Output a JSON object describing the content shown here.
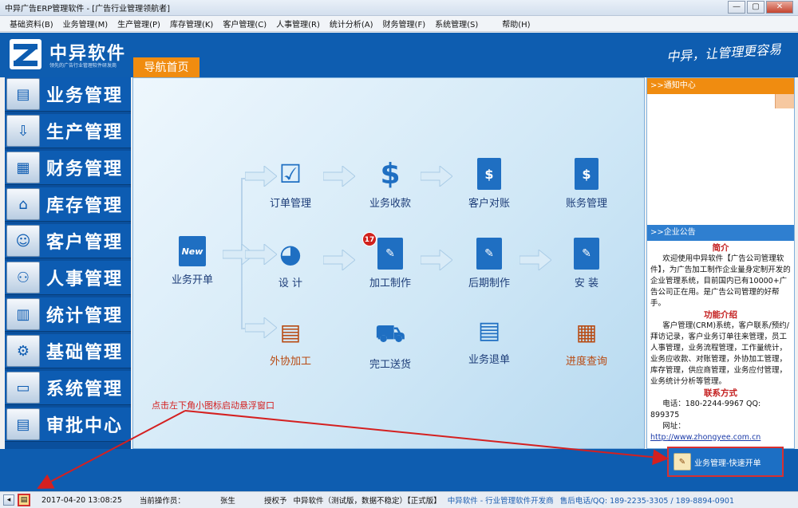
{
  "window": {
    "title": "中异广告ERP管理软件 - [广告行业管理领航者]",
    "minimize": "—",
    "restore": "▢",
    "close": "✕"
  },
  "menu": [
    "基础资料(B)",
    "业务管理(M)",
    "生产管理(P)",
    "库存管理(K)",
    "客户管理(C)",
    "人事管理(R)",
    "统计分析(A)",
    "财务管理(F)",
    "系统管理(S)",
    "帮助(H)"
  ],
  "header": {
    "brand": "中异软件",
    "tagline": "领先的广告行业管理软件研发商",
    "nav_tab": "导航首页",
    "slogan": "中异，让管理更容易"
  },
  "sidebar": {
    "items": [
      {
        "label": "业务管理",
        "icon": "clipboard-icon"
      },
      {
        "label": "生产管理",
        "icon": "download-icon"
      },
      {
        "label": "财务管理",
        "icon": "calculator-icon"
      },
      {
        "label": "库存管理",
        "icon": "warehouse-icon"
      },
      {
        "label": "客户管理",
        "icon": "customer-icon"
      },
      {
        "label": "人事管理",
        "icon": "people-icon"
      },
      {
        "label": "统计管理",
        "icon": "chart-icon"
      },
      {
        "label": "基础管理",
        "icon": "gear-icon"
      },
      {
        "label": "系统管理",
        "icon": "monitor-icon"
      },
      {
        "label": "审批中心",
        "icon": "approval-icon"
      }
    ]
  },
  "flow": {
    "new_icon_text": "New",
    "nodes": {
      "new_order": "业务开单",
      "order_mgmt": "订单管理",
      "biz_collection": "业务收款",
      "customer_reconcile": "客户对账",
      "account_mgmt": "账务管理",
      "design": "设  计",
      "processing": "加工制作",
      "post_production": "后期制作",
      "install": "安  装",
      "outsourcing": "外协加工",
      "delivery": "完工送货",
      "return": "业务退单",
      "progress": "进度查询"
    },
    "processing_badge": "17"
  },
  "annotation": "点击左下角小图标启动悬浮窗口",
  "right_panel": {
    "notice_title": ">>通知中心",
    "announcement_title": ">>企业公告",
    "intro_heading": "简介",
    "intro_text": "欢迎使用中异软件【广告公司管理软件】，为广告加工制作企业量身定制开发的企业管理系统，目前国内已有10000+广告公司正在用。是广告公司管理的好帮手。",
    "features_heading": "功能介绍",
    "features_text": "客户管理(CRM)系统，客户联系/预约/拜访记录，客户业务订单往来管理，员工人事管理，业务流程管理，工作量统计，业务应收款、对账管理，外协加工管理，库存管理，供应商管理，业务应付管理，业务统计分析等管理。",
    "contact_heading": "联系方式",
    "phone_line": "电话：180-2244-9967  QQ: 899375",
    "website_label": "网址：",
    "website": "http://www.zhongyee.com.cn"
  },
  "quick_button": {
    "label": "业务管理-快速开单"
  },
  "status": {
    "datetime": "2017-04-20 13:08:25",
    "operator_label": "当前操作员：",
    "operator": "张生",
    "licensed_label": "授权予",
    "version": "中异软件（测试版，数据不稳定）【正式版】",
    "developer": "中异软件 - 行业管理软件开发商",
    "support": "售后电话/QQ: 189-2235-3305 / 189-8894-0901"
  },
  "colors": {
    "brand_blue": "#0e5db0",
    "accent_orange": "#f08c10",
    "annotation_red": "#d42020"
  }
}
